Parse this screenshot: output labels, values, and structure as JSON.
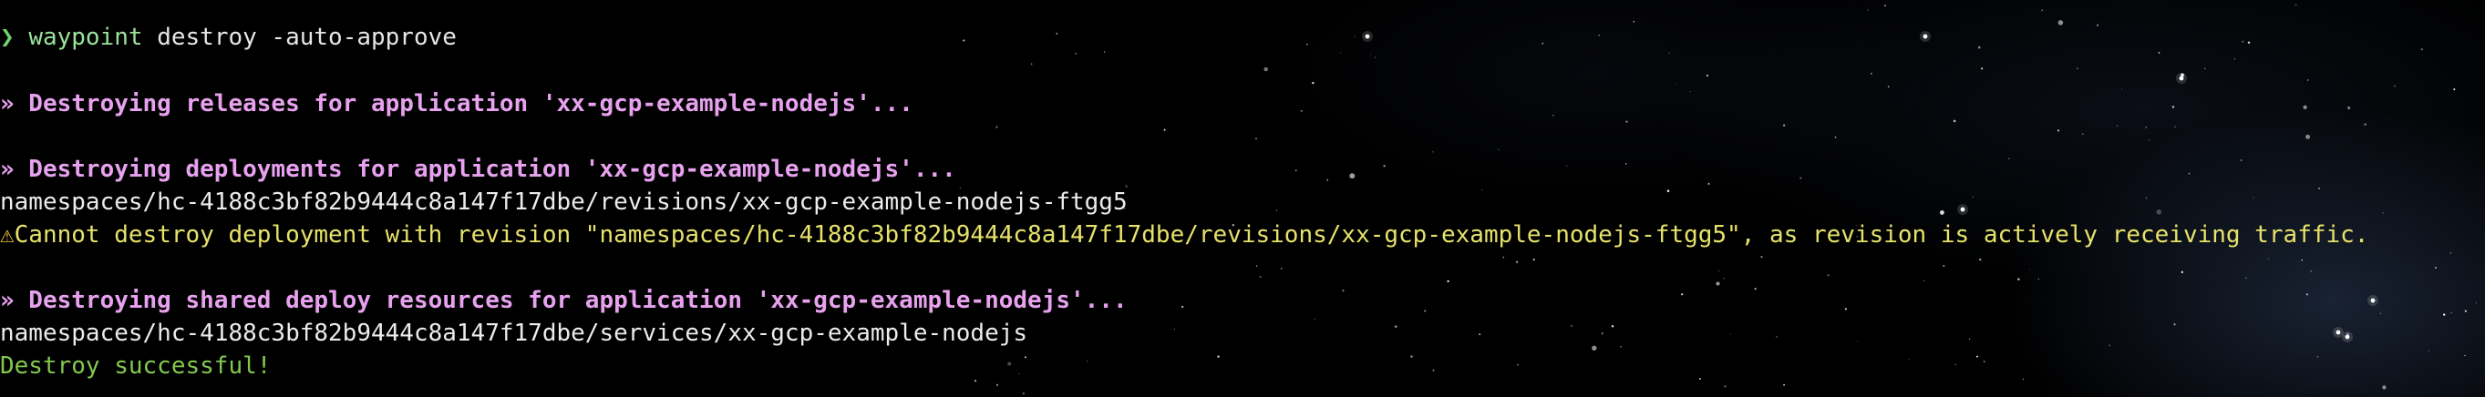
{
  "command": {
    "prompt_glyph": "❯",
    "program": "waypoint",
    "args": " destroy -auto-approve"
  },
  "output": {
    "releases_heading": "» Destroying releases for application 'xx-gcp-example-nodejs'...",
    "deployments_heading": "» Destroying deployments for application 'xx-gcp-example-nodejs'...",
    "revision_path": "namespaces/hc-4188c3bf82b9444c8a147f17dbe/revisions/xx-gcp-example-nodejs-ftgg5",
    "warning_icon": "⚠",
    "warning_text": "Cannot destroy deployment with revision \"namespaces/hc-4188c3bf82b9444c8a147f17dbe/revisions/xx-gcp-example-nodejs-ftgg5\", as revision is actively receiving traffic.",
    "shared_heading": "» Destroying shared deploy resources for application 'xx-gcp-example-nodejs'...",
    "service_path": "namespaces/hc-4188c3bf82b9444c8a147f17dbe/services/xx-gcp-example-nodejs",
    "success_text": "Destroy successful!"
  },
  "theme": {
    "background": "#000000",
    "prompt_color": "#6dd56d",
    "heading_color": "#e7a1ef",
    "warning_color": "#e6e26a",
    "success_color": "#82c84f",
    "text_color": "#ececec",
    "warning_icon_name": "warning-icon"
  }
}
